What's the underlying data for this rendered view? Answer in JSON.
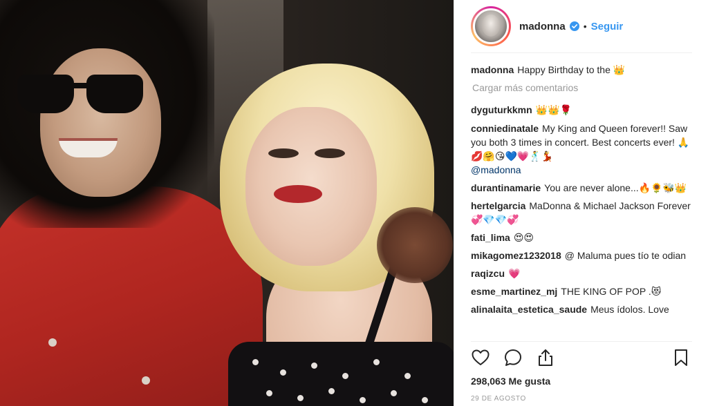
{
  "post": {
    "username": "madonna",
    "follow_label": "Seguir",
    "separator": "•",
    "caption_user": "madonna",
    "caption_text": "Happy Birthday to the 👑",
    "load_more": "Cargar más comentarios",
    "likes": "298,063 Me gusta",
    "date": "29 DE AGOSTO"
  },
  "comments": [
    {
      "user": "dyguturkkmn",
      "text": "👑👑🌹"
    },
    {
      "user": "conniedinatale",
      "text": "My King and Queen forever!! Saw you both 3 times in concert. Best concerts ever! 🙏💋🤗😘💙💗🕺💃",
      "mention": "@madonna"
    },
    {
      "user": "durantinamarie",
      "text": "You are never alone...🔥🌻🐝👑"
    },
    {
      "user": "hertelgarcia",
      "text": "MaDonna & Michael Jackson Forever 💞💎💎💞"
    },
    {
      "user": "fati_lima",
      "text": "😍😍"
    },
    {
      "user": "mikagomez1232018",
      "text": "@ Maluma pues tío te odian"
    },
    {
      "user": "raqizcu",
      "text": "💗"
    },
    {
      "user": "esme_martinez_mj",
      "text": "THE KING OF POP .😻"
    },
    {
      "user": "alinalaita_estetica_saude",
      "text": "Meus ídolos. Love"
    }
  ],
  "icons": {
    "like": "heart-icon",
    "comment": "comment-bubble-icon",
    "share": "share-icon",
    "save": "bookmark-icon",
    "verified": "verified-badge-icon"
  },
  "colors": {
    "link": "#3897f0",
    "text": "#262626",
    "muted": "#999999",
    "mention": "#003569"
  }
}
